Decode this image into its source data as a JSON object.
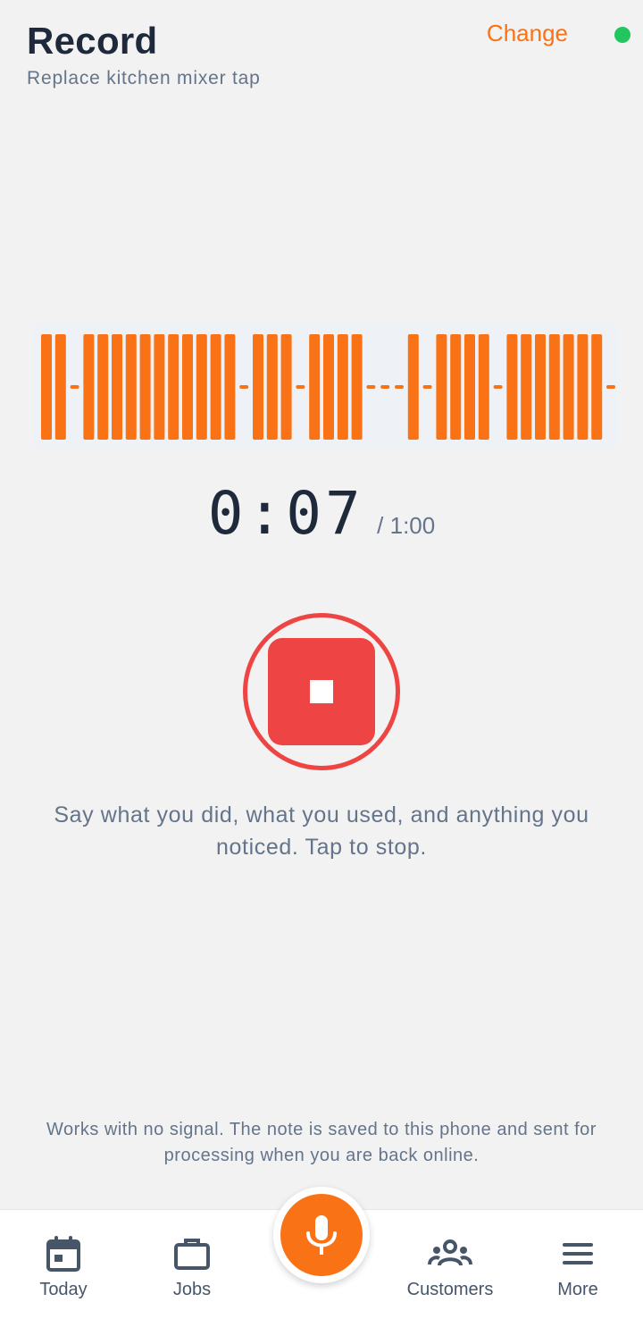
{
  "header": {
    "title": "Record",
    "subtitle": "Replace kitchen mixer tap",
    "change_label": "Change",
    "status_color": "#22c55e"
  },
  "waveform": {
    "color": "#f97316",
    "bars": [
      1,
      1,
      0,
      1,
      1,
      1,
      1,
      1,
      1,
      1,
      1,
      1,
      1,
      1,
      0,
      1,
      1,
      1,
      0,
      1,
      1,
      1,
      1,
      0,
      0,
      0,
      1,
      0,
      1,
      1,
      1,
      1,
      0,
      1,
      1,
      1,
      1,
      1,
      1,
      1,
      0
    ]
  },
  "timer": {
    "elapsed": "0:07",
    "limit": "/ 1:00"
  },
  "stop_button": {
    "icon": "stop-icon",
    "color": "#ef4444"
  },
  "hint": "Say what you did, what you used, and anything you noticed. Tap to stop.",
  "offline_note": "Works with no signal. The note is saved to this phone and sent for processing when you are back online.",
  "tabs": [
    {
      "label": "Today",
      "icon": "calendar-icon"
    },
    {
      "label": "Jobs",
      "icon": "briefcase-icon"
    },
    {
      "label": "Customers",
      "icon": "users-icon"
    },
    {
      "label": "More",
      "icon": "menu-icon"
    }
  ],
  "record_fab": {
    "icon": "microphone-icon",
    "color": "#f97316"
  }
}
